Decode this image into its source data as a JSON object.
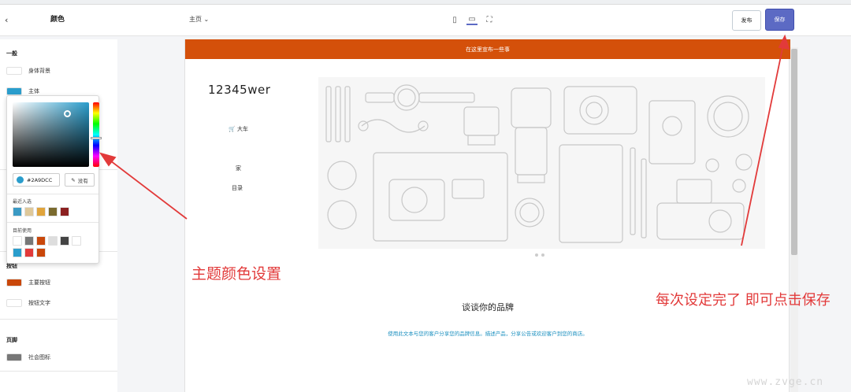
{
  "topbar": {
    "back_icon": "chevron-left-icon",
    "panel_title": "颜色",
    "page_select": "主页 ⌄",
    "devices": [
      "mobile-icon",
      "desktop-icon",
      "fullscreen-icon"
    ],
    "publish_label": "发布",
    "save_label": "保存"
  },
  "sidebar": {
    "general_title": "一般",
    "body_bg_label": "身体背景",
    "primary_label": "主体",
    "buttons_title": "按钮",
    "primary_button_label": "主要按钮",
    "button_text_label": "按钮文字",
    "footer_title": "页脚",
    "social_icon_label": "社会图标",
    "colors": {
      "body_bg": "#ffffff",
      "primary": "#2A9DCC",
      "primary_button": "#c9470a",
      "button_text": "#ffffff",
      "social_icon": "#777777"
    }
  },
  "picker": {
    "hex": "#2A9DCC",
    "none_label": "没有",
    "recent_title": "最近入选",
    "recent_colors": [
      "#3b9ac4",
      "#dec89a",
      "#e0a43c",
      "#7a6a2e",
      "#8b2020"
    ],
    "current_title": "目前使用",
    "current_colors": [
      "#ffffff",
      "#777777",
      "#c9470a",
      "#dddddd",
      "#444444",
      "#ffffff",
      "#2A9DCC",
      "#e23a3a",
      "#c9470a"
    ]
  },
  "preview": {
    "announcement": "在这里宣布一些事",
    "logo": "12345wer",
    "cart_label": "大车",
    "nav_home": "家",
    "nav_catalog": "目录",
    "brand_title": "谈谈你的品牌",
    "brand_text": "使用此文本与您的客户分享您的品牌信息。描述产品，分享公告或欢迎客户到您的商店。"
  },
  "annotations": {
    "theme_color": "主题颜色设置",
    "save_hint": "每次设定完了 即可点击保存"
  },
  "watermark": "www.zvge.cn"
}
